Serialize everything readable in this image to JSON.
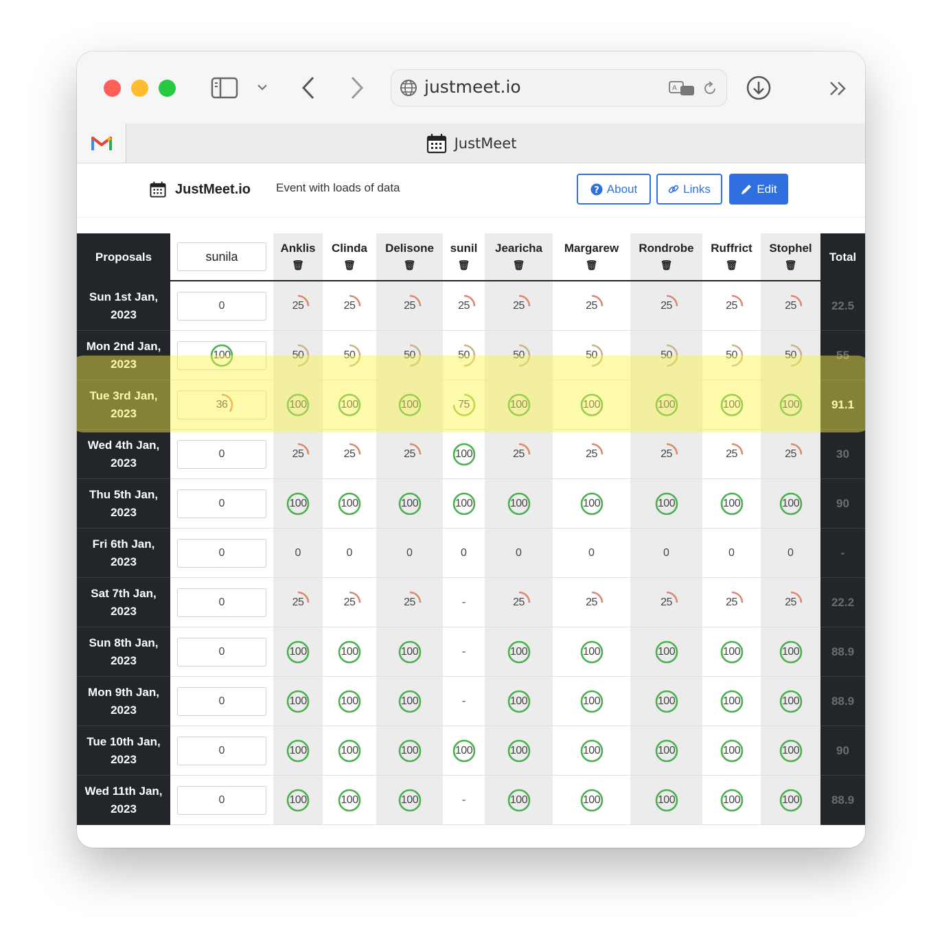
{
  "browser": {
    "url": "justmeet.io",
    "tab_title": "JustMeet",
    "pinned_tab_icon": "gmail-icon"
  },
  "app": {
    "brand": "JustMeet.io",
    "event_title": "Event with loads of data",
    "buttons": {
      "about": "About",
      "links": "Links",
      "edit": "Edit"
    }
  },
  "table": {
    "proposals_header": "Proposals",
    "total_header": "Total",
    "current_user": "sunila",
    "participants": [
      "Anklis",
      "Clinda",
      "Delisone",
      "sunil",
      "Jearicha",
      "Margarew",
      "Rondrobe",
      "Ruffrict",
      "Stophel"
    ],
    "rows": [
      {
        "date": "Sun 1st Jan, 2023",
        "input": "0",
        "scores": [
          "25",
          "25",
          "25",
          "25",
          "25",
          "25",
          "25",
          "25",
          "25"
        ],
        "total": "22.5"
      },
      {
        "date": "Mon 2nd Jan, 2023",
        "input": "100",
        "scores": [
          "50",
          "50",
          "50",
          "50",
          "50",
          "50",
          "50",
          "50",
          "50"
        ],
        "total": "55"
      },
      {
        "date": "Tue 3rd Jan, 2023",
        "input": "36",
        "scores": [
          "100",
          "100",
          "100",
          "75",
          "100",
          "100",
          "100",
          "100",
          "100"
        ],
        "total": "91.1",
        "highlighted": true
      },
      {
        "date": "Wed 4th Jan, 2023",
        "input": "0",
        "scores": [
          "25",
          "25",
          "25",
          "100",
          "25",
          "25",
          "25",
          "25",
          "25"
        ],
        "total": "30"
      },
      {
        "date": "Thu 5th Jan, 2023",
        "input": "0",
        "scores": [
          "100",
          "100",
          "100",
          "100",
          "100",
          "100",
          "100",
          "100",
          "100"
        ],
        "total": "90"
      },
      {
        "date": "Fri 6th Jan, 2023",
        "input": "0",
        "scores": [
          "0",
          "0",
          "0",
          "0",
          "0",
          "0",
          "0",
          "0",
          "0"
        ],
        "total": "-"
      },
      {
        "date": "Sat 7th Jan, 2023",
        "input": "0",
        "scores": [
          "25",
          "25",
          "25",
          "-",
          "25",
          "25",
          "25",
          "25",
          "25"
        ],
        "total": "22.2"
      },
      {
        "date": "Sun 8th Jan, 2023",
        "input": "0",
        "scores": [
          "100",
          "100",
          "100",
          "-",
          "100",
          "100",
          "100",
          "100",
          "100"
        ],
        "total": "88.9"
      },
      {
        "date": "Mon 9th Jan, 2023",
        "input": "0",
        "scores": [
          "100",
          "100",
          "100",
          "-",
          "100",
          "100",
          "100",
          "100",
          "100"
        ],
        "total": "88.9"
      },
      {
        "date": "Tue 10th Jan, 2023",
        "input": "0",
        "scores": [
          "100",
          "100",
          "100",
          "100",
          "100",
          "100",
          "100",
          "100",
          "100"
        ],
        "total": "90"
      },
      {
        "date": "Wed 11th Jan, 2023",
        "input": "0",
        "scores": [
          "100",
          "100",
          "100",
          "-",
          "100",
          "100",
          "100",
          "100",
          "100"
        ],
        "total": "88.9"
      }
    ]
  },
  "colors": {
    "score_100": "#4caf50",
    "score_75": "#8bc34a",
    "score_50": "#c9b389",
    "score_25": "#d98a6f",
    "accent": "#2f6fe0",
    "highlight": "#faf546"
  }
}
